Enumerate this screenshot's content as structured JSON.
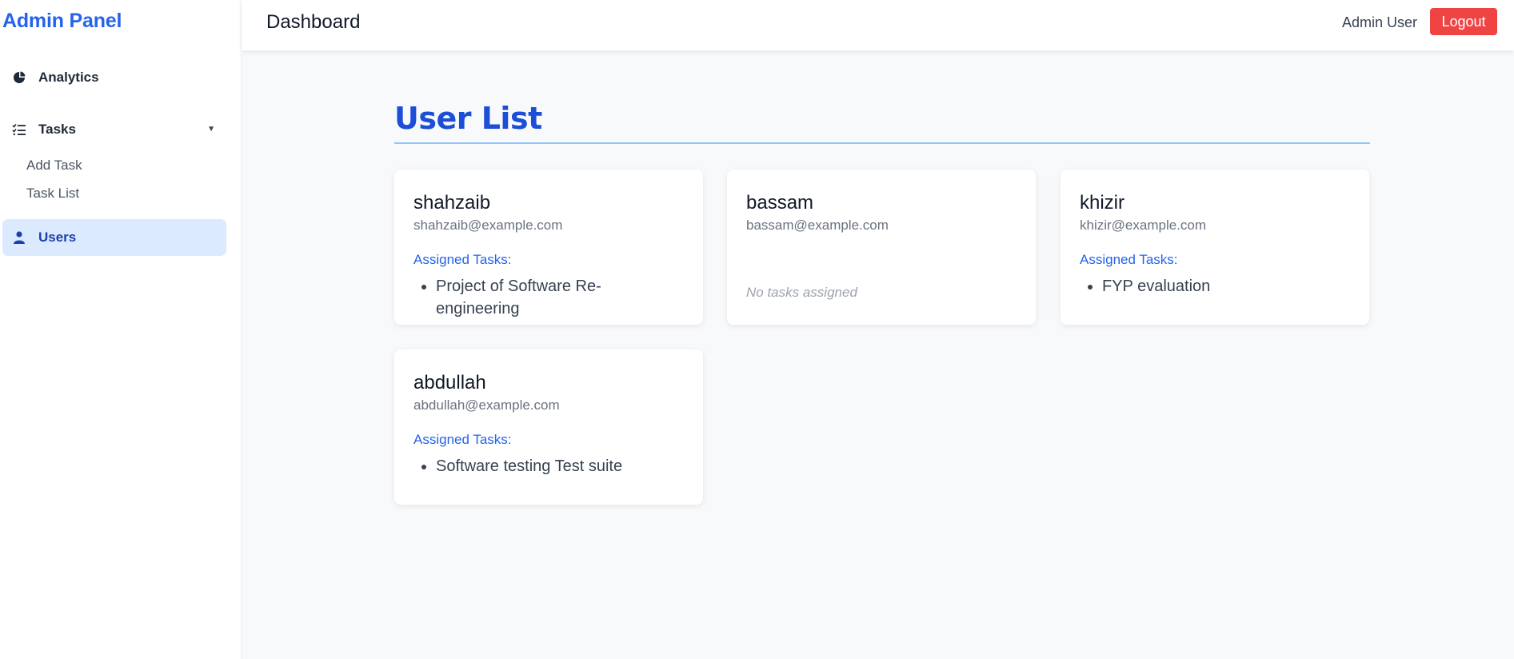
{
  "sidebar": {
    "brand": "Admin Panel",
    "items": [
      {
        "label": "Analytics",
        "icon": "pie-chart-icon"
      },
      {
        "label": "Tasks",
        "icon": "list-check-icon"
      },
      {
        "label": "Users",
        "icon": "user-icon",
        "active": true
      }
    ],
    "task_subitems": [
      "Add Task",
      "Task List"
    ]
  },
  "header": {
    "title": "Dashboard",
    "user": "Admin User",
    "logout_label": "Logout"
  },
  "main": {
    "title": "User List",
    "users": [
      {
        "name": "shahzaib",
        "email": "shahzaib@example.com",
        "tasks_label": "Assigned Tasks:",
        "tasks": [
          "Project of Software Re-engineering"
        ]
      },
      {
        "name": "bassam",
        "email": "bassam@example.com",
        "no_tasks": "No tasks assigned"
      },
      {
        "name": "khizir",
        "email": "khizir@example.com",
        "tasks_label": "Assigned Tasks:",
        "tasks": [
          "FYP evaluation"
        ]
      },
      {
        "name": "abdullah",
        "email": "abdullah@example.com",
        "tasks_label": "Assigned Tasks:",
        "tasks": [
          "Software testing Test suite"
        ]
      }
    ]
  },
  "colors": {
    "accent": "#2563eb",
    "active_bg": "#dbeafe",
    "logout": "#ef4444"
  }
}
